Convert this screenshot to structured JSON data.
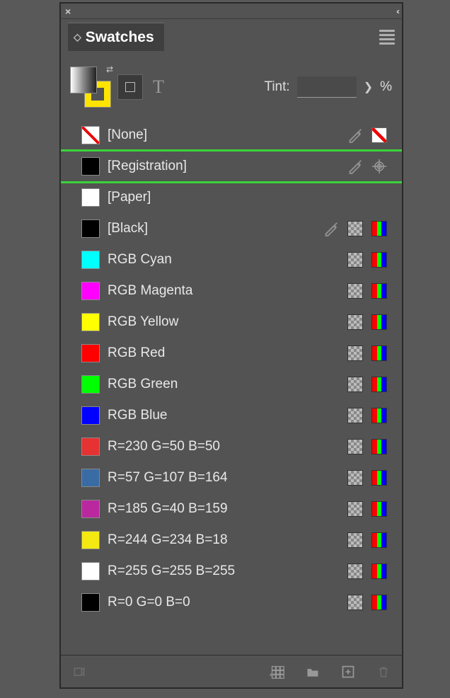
{
  "panel": {
    "title": "Swatches",
    "tint_label": "Tint:",
    "tint_value": "",
    "tint_unit": "%"
  },
  "swatches": [
    {
      "name": "[None]",
      "color": "none",
      "icons": [
        "noedit",
        "none"
      ]
    },
    {
      "name": "[Registration]",
      "color": "#000000",
      "icons": [
        "noedit",
        "registration"
      ],
      "highlight": true
    },
    {
      "name": "[Paper]",
      "color": "#ffffff",
      "icons": []
    },
    {
      "name": "[Black]",
      "color": "#000000",
      "icons": [
        "noedit",
        "checker",
        "rgb"
      ]
    },
    {
      "name": "RGB Cyan",
      "color": "#00ffff",
      "icons": [
        "checker",
        "rgb"
      ]
    },
    {
      "name": "RGB Magenta",
      "color": "#ff00ff",
      "icons": [
        "checker",
        "rgb"
      ]
    },
    {
      "name": "RGB Yellow",
      "color": "#ffff00",
      "icons": [
        "checker",
        "rgb"
      ]
    },
    {
      "name": "RGB Red",
      "color": "#ff0000",
      "icons": [
        "checker",
        "rgb"
      ]
    },
    {
      "name": "RGB Green",
      "color": "#00ff00",
      "icons": [
        "checker",
        "rgb"
      ]
    },
    {
      "name": "RGB Blue",
      "color": "#0000ff",
      "icons": [
        "checker",
        "rgb"
      ]
    },
    {
      "name": "R=230 G=50 B=50",
      "color": "#e63232",
      "icons": [
        "checker",
        "rgb"
      ]
    },
    {
      "name": "R=57 G=107 B=164",
      "color": "#396ba4",
      "icons": [
        "checker",
        "rgb"
      ]
    },
    {
      "name": "R=185 G=40 B=159",
      "color": "#b9289f",
      "icons": [
        "checker",
        "rgb"
      ]
    },
    {
      "name": "R=244 G=234 B=18",
      "color": "#f4ea12",
      "icons": [
        "checker",
        "rgb"
      ]
    },
    {
      "name": "R=255 G=255 B=255",
      "color": "#ffffff",
      "icons": [
        "checker",
        "rgb"
      ]
    },
    {
      "name": "R=0 G=0 B=0",
      "color": "#000000",
      "icons": [
        "checker",
        "rgb"
      ]
    }
  ],
  "footer": {
    "add_to_cc": "add-to-cc-libraries",
    "view_mode": "swatch-view",
    "new_group": "new-group",
    "new_swatch": "new-swatch",
    "delete": "delete-swatch"
  }
}
